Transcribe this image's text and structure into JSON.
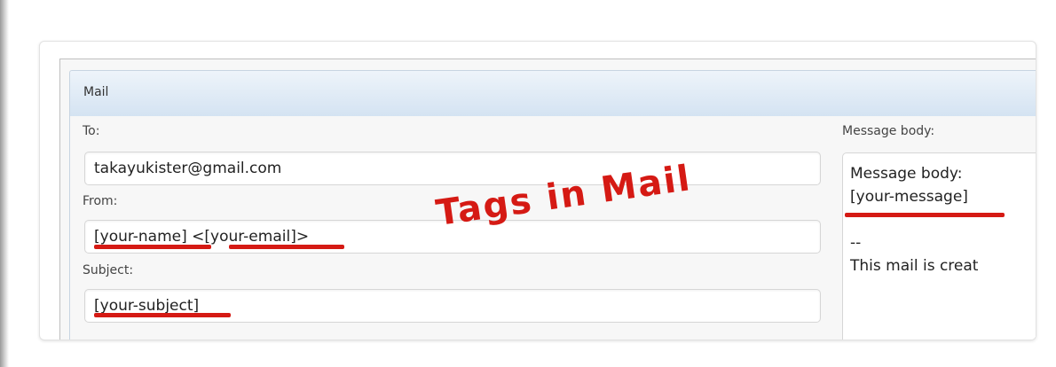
{
  "panel": {
    "title": "Mail"
  },
  "fields": {
    "to": {
      "label": "To:",
      "value": "takayukister@gmail.com"
    },
    "from": {
      "label": "From:",
      "tag_name": "[your-name]",
      "separator": " <",
      "tag_email": "[your-email]",
      "suffix": ">"
    },
    "subject": {
      "label": "Subject:",
      "value": "[your-subject]"
    },
    "message_body": {
      "label": "Message body:",
      "heading": "Message body:",
      "tag": "[your-message]",
      "text": "\n\n--\nThis mail is creat"
    }
  },
  "annotation": {
    "text": "Tags in Mail",
    "color": "#d51a14"
  }
}
